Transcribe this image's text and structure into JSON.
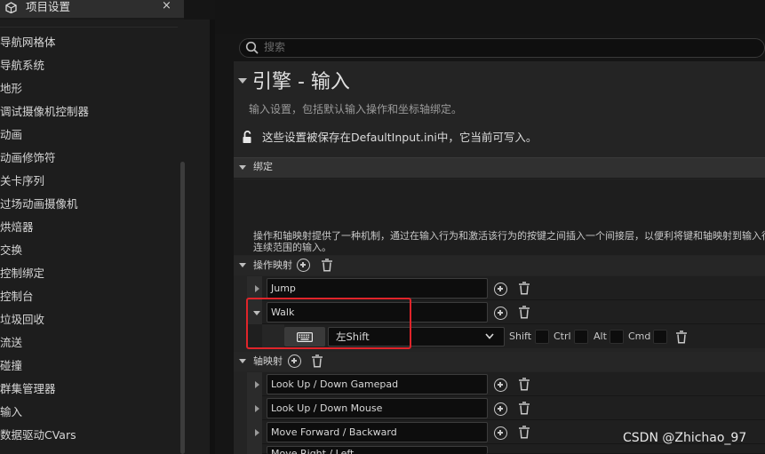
{
  "window": {
    "tab_title": "项目设置",
    "close_glyph": "×",
    "icon": "project-settings-icon"
  },
  "sidebar": {
    "items": [
      {
        "label": "导航网格体"
      },
      {
        "label": "导航系统"
      },
      {
        "label": "地形"
      },
      {
        "label": "调试摄像机控制器"
      },
      {
        "label": "动画"
      },
      {
        "label": "动画修饰符"
      },
      {
        "label": "关卡序列"
      },
      {
        "label": "过场动画摄像机"
      },
      {
        "label": "烘焙器"
      },
      {
        "label": "交换"
      },
      {
        "label": "控制绑定"
      },
      {
        "label": "控制台"
      },
      {
        "label": "垃圾回收"
      },
      {
        "label": "流送"
      },
      {
        "label": "碰撞"
      },
      {
        "label": "群集管理器"
      },
      {
        "label": "输入"
      },
      {
        "label": "数据驱动CVars"
      }
    ]
  },
  "search": {
    "placeholder": "搜索",
    "icon": "search-icon"
  },
  "page": {
    "title": "引擎 - 输入",
    "description": "输入设置，包括默认输入操作和坐标轴绑定。",
    "save_notice": "这些设置被保存在DefaultInput.ini中，它当前可写入。",
    "lock_icon": "unlock-icon"
  },
  "bindings": {
    "section_label": "绑定",
    "description": "操作和轴映射提供了一种机制，通过在输入行为和激活该行为的按键之间插入一个间接层，以便利将键和轴映射到输入行为。",
    "description_line2": "连续范围的输入。",
    "action_mappings": {
      "label": "操作映射",
      "items": [
        {
          "name": "Jump"
        },
        {
          "name": "Walk"
        }
      ],
      "walk_key": {
        "key": "左Shift",
        "shift_label": "Shift",
        "ctrl_label": "Ctrl",
        "alt_label": "Alt",
        "cmd_label": "Cmd",
        "shift": false,
        "ctrl": false,
        "alt": false,
        "cmd": false
      }
    },
    "axis_mappings": {
      "label": "轴映射",
      "items": [
        {
          "name": "Look Up / Down Gamepad"
        },
        {
          "name": "Look Up / Down Mouse"
        },
        {
          "name": "Move Forward / Backward"
        },
        {
          "name": "Move Right / Left"
        }
      ]
    }
  },
  "watermark": "CSDN @Zhichao_97",
  "colors": {
    "highlight": "#e0242a",
    "panel": "#242424",
    "input_bg": "#0d0d0d"
  }
}
